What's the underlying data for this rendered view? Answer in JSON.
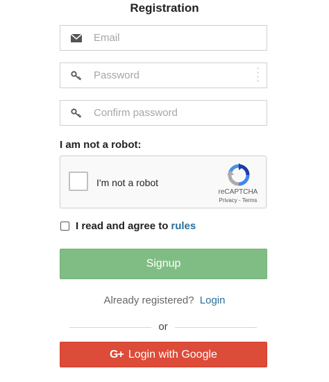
{
  "header": {
    "title": "Registration"
  },
  "form": {
    "email": {
      "placeholder": "Email",
      "value": "",
      "icon": "envelope-icon"
    },
    "password": {
      "placeholder": "Password",
      "value": "",
      "icon": "key-icon"
    },
    "confirm_password": {
      "placeholder": "Confirm password",
      "value": "",
      "icon": "key-icon"
    }
  },
  "captcha": {
    "section_label": "I am not a robot:",
    "checkbox_label": "I'm not a robot",
    "brand": "reCAPTCHA",
    "privacy": "Privacy",
    "separator": " - ",
    "terms": "Terms"
  },
  "agree": {
    "text": "I read and agree to",
    "link": "rules"
  },
  "signup": {
    "label": "Signup"
  },
  "already": {
    "text": "Already registered?",
    "link": "Login"
  },
  "divider": {
    "text": "or"
  },
  "google": {
    "icon_text": "G+",
    "label": "Login with Google"
  },
  "colors": {
    "signup_bg": "#80bd84",
    "google_bg": "#dd4b39",
    "link": "#2a6f97"
  }
}
